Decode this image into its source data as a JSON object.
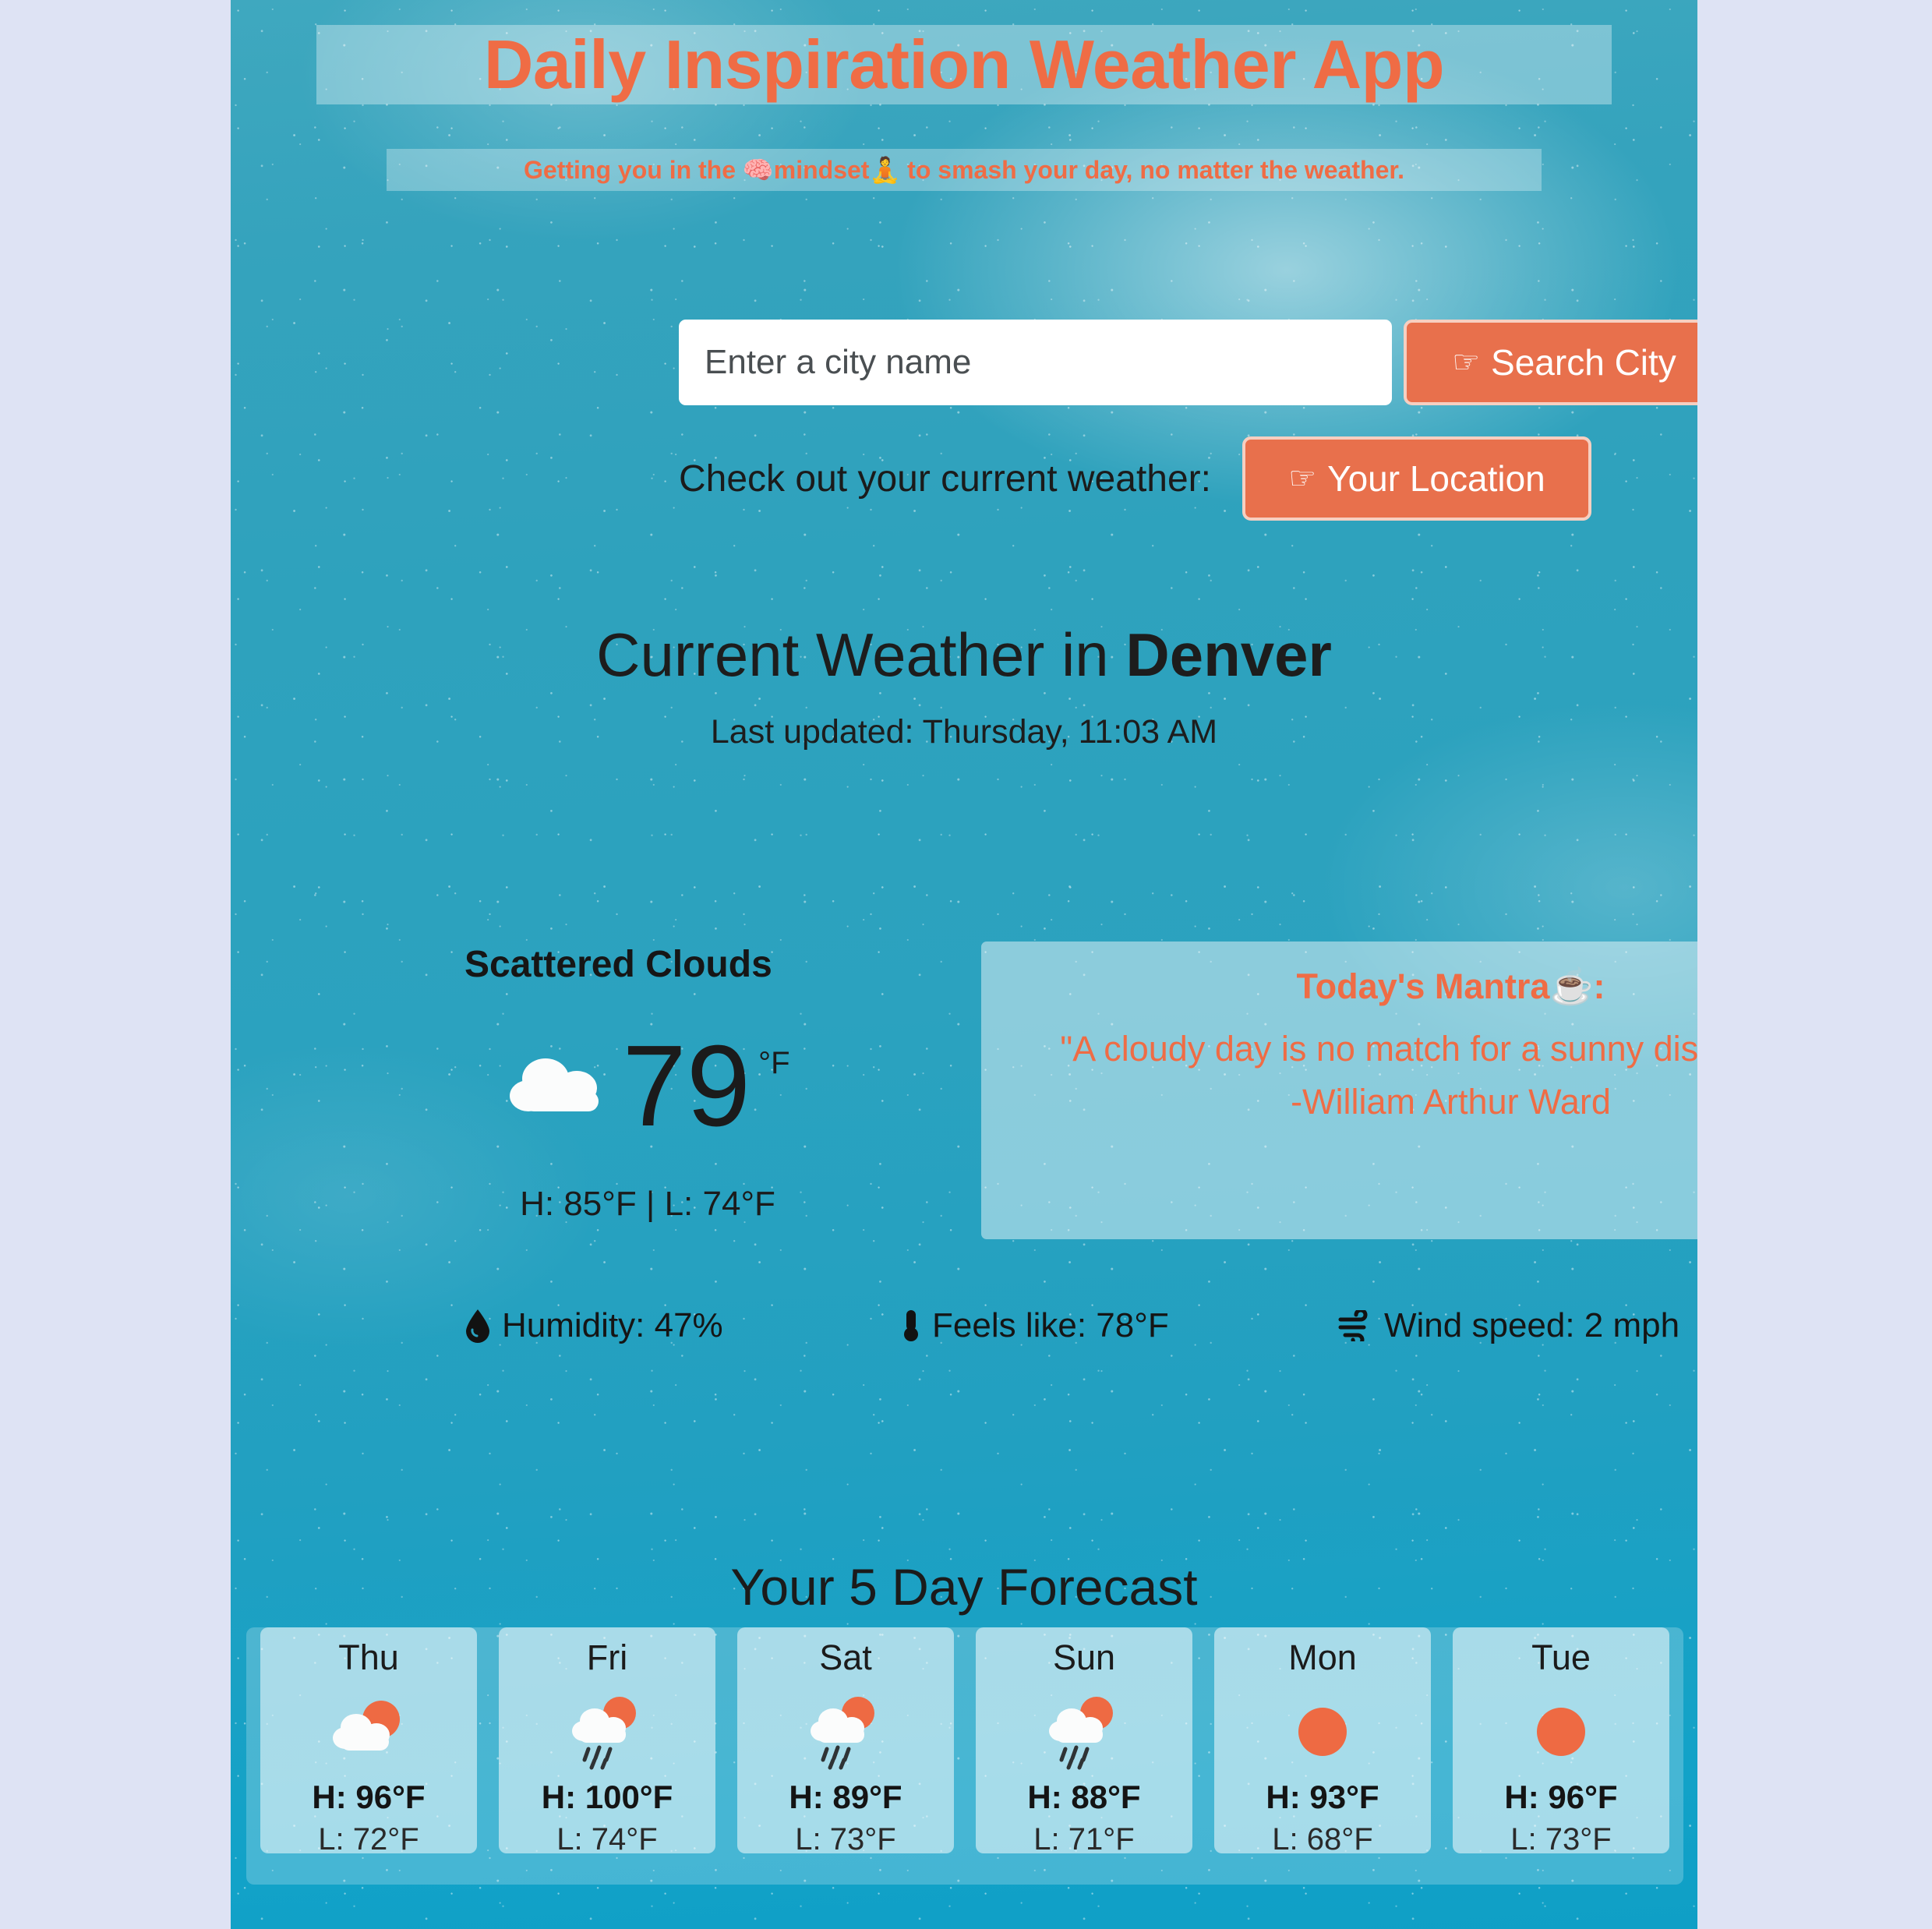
{
  "theme": {
    "accent_orange": "#e8704c",
    "title_orange": "#ef6c45",
    "page_background": "#dee3f4",
    "card_translucent_white": "rgba(255,255,255,0.46)"
  },
  "header": {
    "title": "Daily Inspiration Weather App",
    "subtitle": "Getting you in the 🧠mindset🧘 to smash your day, no matter the weather."
  },
  "search": {
    "placeholder": "Enter a city name",
    "value": "",
    "search_button_label": "Search City",
    "search_button_icon": "pointing-hand-icon",
    "location_prompt": "Check out your current weather:",
    "location_button_label": "Your Location",
    "location_button_icon": "pointing-hand-icon"
  },
  "current": {
    "heading_prefix": "Current Weather in ",
    "city": "Denver",
    "last_updated": "Last updated: Thursday, 11:03 AM",
    "condition": "Scattered Clouds",
    "condition_icon": "cloud-icon",
    "temperature": "79",
    "temperature_unit": "°F",
    "high_low": "H: 85°F | L: 74°F",
    "high": "85°F",
    "low": "74°F"
  },
  "mantra": {
    "title": "Today's Mantra☕:",
    "quote": "\"A cloudy day is no match for a sunny disposition.\"",
    "author": "-William Arthur Ward"
  },
  "metrics": [
    {
      "icon": "water-droplet-icon",
      "glyph": "💧",
      "label": "Humidity: 47%"
    },
    {
      "icon": "thermometer-icon",
      "glyph": "🌡",
      "label": "Feels like: 78°F"
    },
    {
      "icon": "wind-icon",
      "glyph": "🌬",
      "label": "Wind speed: 2 mph"
    }
  ],
  "forecast": {
    "title": "Your 5 Day Forecast",
    "days": [
      {
        "day": "Thu",
        "icon": "sun-behind-cloud-icon",
        "high": "H: 96°F",
        "low": "L: 72°F"
      },
      {
        "day": "Fri",
        "icon": "sun-behind-rain-cloud-icon",
        "high": "H: 100°F",
        "low": "L: 74°F"
      },
      {
        "day": "Sat",
        "icon": "sun-behind-rain-cloud-icon",
        "high": "H: 89°F",
        "low": "L: 73°F"
      },
      {
        "day": "Sun",
        "icon": "sun-behind-rain-cloud-icon",
        "high": "H: 88°F",
        "low": "L: 71°F"
      },
      {
        "day": "Mon",
        "icon": "sun-icon",
        "high": "H: 93°F",
        "low": "L: 68°F"
      },
      {
        "day": "Tue",
        "icon": "sun-icon",
        "high": "H: 96°F",
        "low": "L: 73°F"
      }
    ]
  }
}
